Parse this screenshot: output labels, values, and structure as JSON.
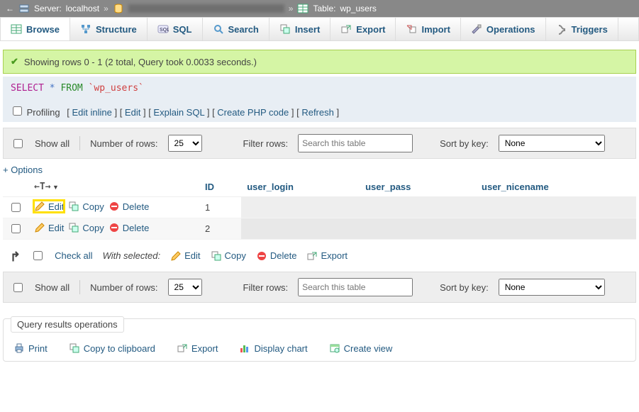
{
  "breadcrumb": {
    "arrow": "←",
    "server_label": "Server:",
    "server_name": "localhost",
    "sep": "»",
    "table_label": "Table:",
    "table_name": "wp_users"
  },
  "tabs": [
    {
      "key": "browse",
      "label": "Browse",
      "active": true
    },
    {
      "key": "structure",
      "label": "Structure"
    },
    {
      "key": "sql",
      "label": "SQL"
    },
    {
      "key": "search",
      "label": "Search"
    },
    {
      "key": "insert",
      "label": "Insert"
    },
    {
      "key": "export",
      "label": "Export"
    },
    {
      "key": "import",
      "label": "Import"
    },
    {
      "key": "operations",
      "label": "Operations"
    },
    {
      "key": "triggers",
      "label": "Triggers"
    }
  ],
  "success_msg": "Showing rows 0 - 1 (2 total, Query took 0.0033 seconds.)",
  "sql": {
    "select": "SELECT",
    "star": "*",
    "from": "FROM",
    "table": "`wp_users`"
  },
  "linkbar": {
    "profiling": "Profiling",
    "edit_inline": "Edit inline",
    "edit": "Edit",
    "explain": "Explain SQL",
    "create_php": "Create PHP code",
    "refresh": "Refresh"
  },
  "ctrl": {
    "show_all": "Show all",
    "num_rows": "Number of rows:",
    "rows_value": "25",
    "filter_rows": "Filter rows:",
    "search_placeholder": "Search this table",
    "sort_by_key": "Sort by key:",
    "sort_value": "None"
  },
  "options_label": "+ Options",
  "columns": [
    "ID",
    "user_login",
    "user_pass",
    "user_nicename"
  ],
  "row_actions": {
    "edit": "Edit",
    "copy": "Copy",
    "delete": "Delete"
  },
  "rows": [
    {
      "id": "1"
    },
    {
      "id": "2"
    }
  ],
  "checkall": {
    "check_all": "Check all",
    "with_selected": "With selected:",
    "edit": "Edit",
    "copy": "Copy",
    "delete": "Delete",
    "export": "Export"
  },
  "panel": {
    "title": "Query results operations",
    "print": "Print",
    "copy_clip": "Copy to clipboard",
    "export": "Export",
    "display_chart": "Display chart",
    "create_view": "Create view"
  }
}
